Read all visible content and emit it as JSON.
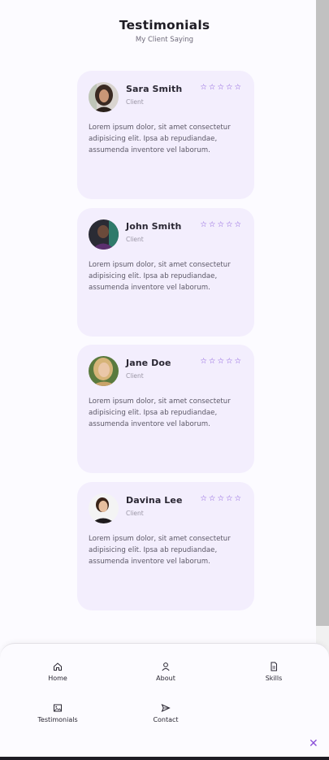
{
  "header": {
    "title": "Testimonials",
    "subtitle": "My Client Saying"
  },
  "testimonials": [
    {
      "name": "Sara Smith",
      "role": "Client",
      "rating": 5,
      "stars": "☆☆☆☆☆",
      "text": "Lorem ipsum dolor, sit amet consectetur adipisicing elit. Ipsa ab repudiandae, assumenda inventore vel laborum."
    },
    {
      "name": "John Smith",
      "role": "Client",
      "rating": 5,
      "stars": "☆☆☆☆☆",
      "text": "Lorem ipsum dolor, sit amet consectetur adipisicing elit. Ipsa ab repudiandae, assumenda inventore vel laborum."
    },
    {
      "name": "Jane Doe",
      "role": "Client",
      "rating": 5,
      "stars": "☆☆☆☆☆",
      "text": "Lorem ipsum dolor, sit amet consectetur adipisicing elit. Ipsa ab repudiandae, assumenda inventore vel laborum."
    },
    {
      "name": "Davina Lee",
      "role": "Client",
      "rating": 5,
      "stars": "☆☆☆☆☆",
      "text": "Lorem ipsum dolor, sit amet consectetur adipisicing elit. Ipsa ab repudiandae, assumenda inventore vel laborum."
    }
  ],
  "nav": {
    "items": [
      {
        "label": "Home",
        "icon": "home-icon"
      },
      {
        "label": "About",
        "icon": "user-icon"
      },
      {
        "label": "Skills",
        "icon": "file-icon"
      },
      {
        "label": "Testimonials",
        "icon": "image-icon"
      },
      {
        "label": "Contact",
        "icon": "send-icon"
      }
    ],
    "close_icon": "close-icon"
  },
  "colors": {
    "accent": "#7a45d8",
    "card_bg": "#f3eefd",
    "page_bg": "#fcfbff"
  }
}
